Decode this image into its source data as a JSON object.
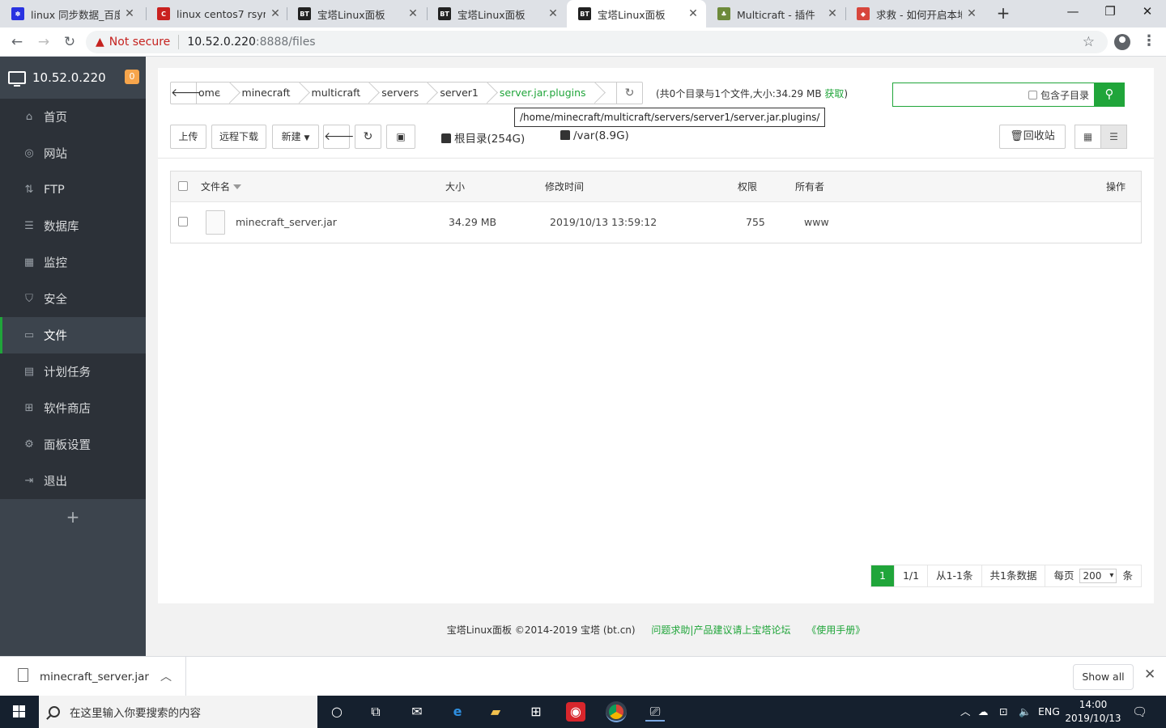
{
  "browser": {
    "tabs": [
      {
        "title": "linux 同步数据_百度",
        "icon": "baidu-paw-icon",
        "color": "#2932e1",
        "glyph": "",
        "active": false
      },
      {
        "title": "linux centos7 rsync",
        "icon": "csdn-c-icon",
        "color": "#c9211f",
        "glyph": "C",
        "active": false
      },
      {
        "title": "宝塔Linux面板",
        "icon": "bt-icon",
        "color": "#222222",
        "glyph": "BT",
        "active": false
      },
      {
        "title": "宝塔Linux面板",
        "icon": "bt-icon",
        "color": "#222222",
        "glyph": "BT",
        "active": false
      },
      {
        "title": "宝塔Linux面板",
        "icon": "bt-icon",
        "color": "#222222",
        "glyph": "BT",
        "active": true
      },
      {
        "title": "Multicraft - 插件",
        "icon": "multicraft-icon",
        "color": "#6d8a3a",
        "glyph": "",
        "active": false
      },
      {
        "title": "求救 - 如何开启本地",
        "icon": "forum-icon",
        "color": "#d7463c",
        "glyph": "",
        "active": false
      }
    ],
    "not_secure": "Not secure",
    "url_host": "10.52.0.220",
    "url_path": ":8888/files"
  },
  "sidebar": {
    "server": "10.52.0.220",
    "badge": "0",
    "items": [
      {
        "label": "首页",
        "icon": "home-icon",
        "glyph": "⌂",
        "active": false
      },
      {
        "label": "网站",
        "icon": "globe-icon",
        "glyph": "◎",
        "active": false
      },
      {
        "label": "FTP",
        "icon": "ftp-icon",
        "glyph": "⇅",
        "active": false
      },
      {
        "label": "数据库",
        "icon": "database-icon",
        "glyph": "☰",
        "active": false
      },
      {
        "label": "监控",
        "icon": "monitor-icon",
        "glyph": "▦",
        "active": false
      },
      {
        "label": "安全",
        "icon": "shield-icon",
        "glyph": "⛉",
        "active": false
      },
      {
        "label": "文件",
        "icon": "folder-icon",
        "glyph": "▭",
        "active": true
      },
      {
        "label": "计划任务",
        "icon": "calendar-icon",
        "glyph": "▤",
        "active": false
      },
      {
        "label": "软件商店",
        "icon": "apps-icon",
        "glyph": "⊞",
        "active": false
      },
      {
        "label": "面板设置",
        "icon": "gear-icon",
        "glyph": "⚙",
        "active": false
      },
      {
        "label": "退出",
        "icon": "logout-icon",
        "glyph": "⇥",
        "active": false
      }
    ],
    "add": "+"
  },
  "files": {
    "breadcrumb": [
      "ome",
      "minecraft",
      "multicraft",
      "servers",
      "server1",
      "server.jar.plugins"
    ],
    "dir_info_prefix": "(共0个目录与1个文件,大小:34.29 MB ",
    "dir_info_link": "获取",
    "dir_info_suffix": ")",
    "path_tooltip": "/home/minecraft/multicraft/servers/server1/server.jar.plugins/",
    "search_placeholder": "",
    "include_subdir": "包含子目录",
    "toolbar": {
      "upload": "上传",
      "remote_download": "远程下载",
      "new": "新建",
      "root_disk": "根目录(254G)",
      "var_disk": "/var(8.9G)",
      "recycle": "回收站"
    },
    "columns": {
      "name": "文件名",
      "size": "大小",
      "mtime": "修改时间",
      "perm": "权限",
      "owner": "所有者",
      "ops": "操作"
    },
    "rows": [
      {
        "name": "minecraft_server.jar",
        "size": "34.29 MB",
        "mtime": "2019/10/13 13:59:12",
        "perm": "755",
        "owner": "www"
      }
    ],
    "pager": {
      "current": "1",
      "pages": "1/1",
      "range": "从1-1条",
      "total": "共1条数据",
      "per_page_label": "每页",
      "per_page": "200",
      "unit": "条"
    }
  },
  "footer": {
    "copyright": "宝塔Linux面板 ©2014-2019 宝塔 (bt.cn)",
    "forum_link": "问题求助|产品建议请上宝塔论坛",
    "manual_link": "《使用手册》"
  },
  "downloads": {
    "file": "minecraft_server.jar",
    "show_all": "Show all"
  },
  "taskbar": {
    "search_placeholder": "在这里输入你要搜索的内容",
    "lang": "ENG",
    "time": "14:00",
    "date": "2019/10/13"
  },
  "colors": {
    "accent": "#20a53a",
    "sidebar_bg": "#3c444d",
    "sidebar_menu_bg": "#2c3138",
    "badge": "#f7a54b"
  }
}
